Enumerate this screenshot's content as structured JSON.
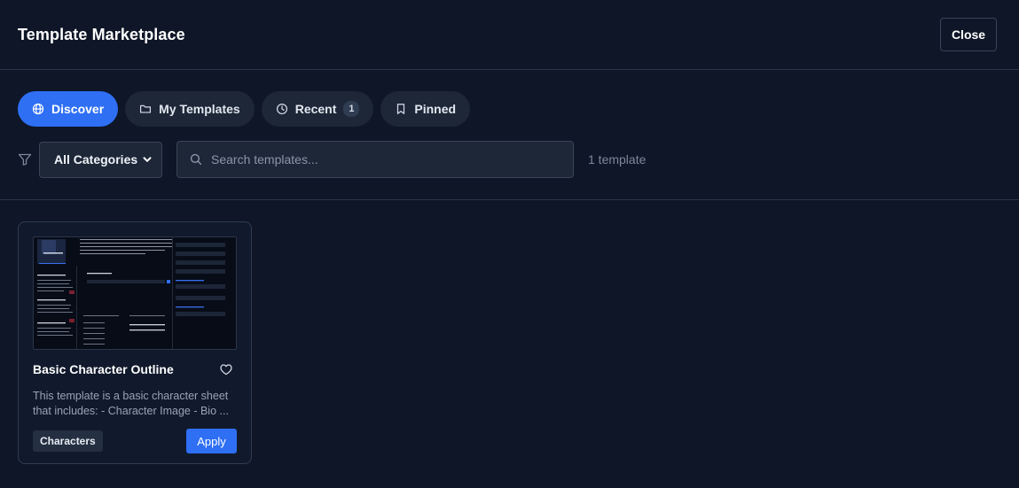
{
  "header": {
    "title": "Template Marketplace",
    "close_label": "Close"
  },
  "tabs": [
    {
      "label": "Discover",
      "icon": "globe-icon",
      "active": true
    },
    {
      "label": "My Templates",
      "icon": "folder-icon"
    },
    {
      "label": "Recent",
      "icon": "clock-icon",
      "count": "1"
    },
    {
      "label": "Pinned",
      "icon": "bookmark-icon"
    }
  ],
  "filters": {
    "category_selected": "All Categories",
    "search_placeholder": "Search templates...",
    "result_count": "1 template"
  },
  "templates": [
    {
      "title": "Basic Character Outline",
      "description": "This template is a basic character sheet that includes: - Character Image - Bio ...",
      "category": "Characters",
      "apply_label": "Apply"
    }
  ],
  "colors": {
    "accent": "#2e6ff4",
    "background": "#0e1627",
    "surface": "#1d2738",
    "border": "#3a4456"
  }
}
